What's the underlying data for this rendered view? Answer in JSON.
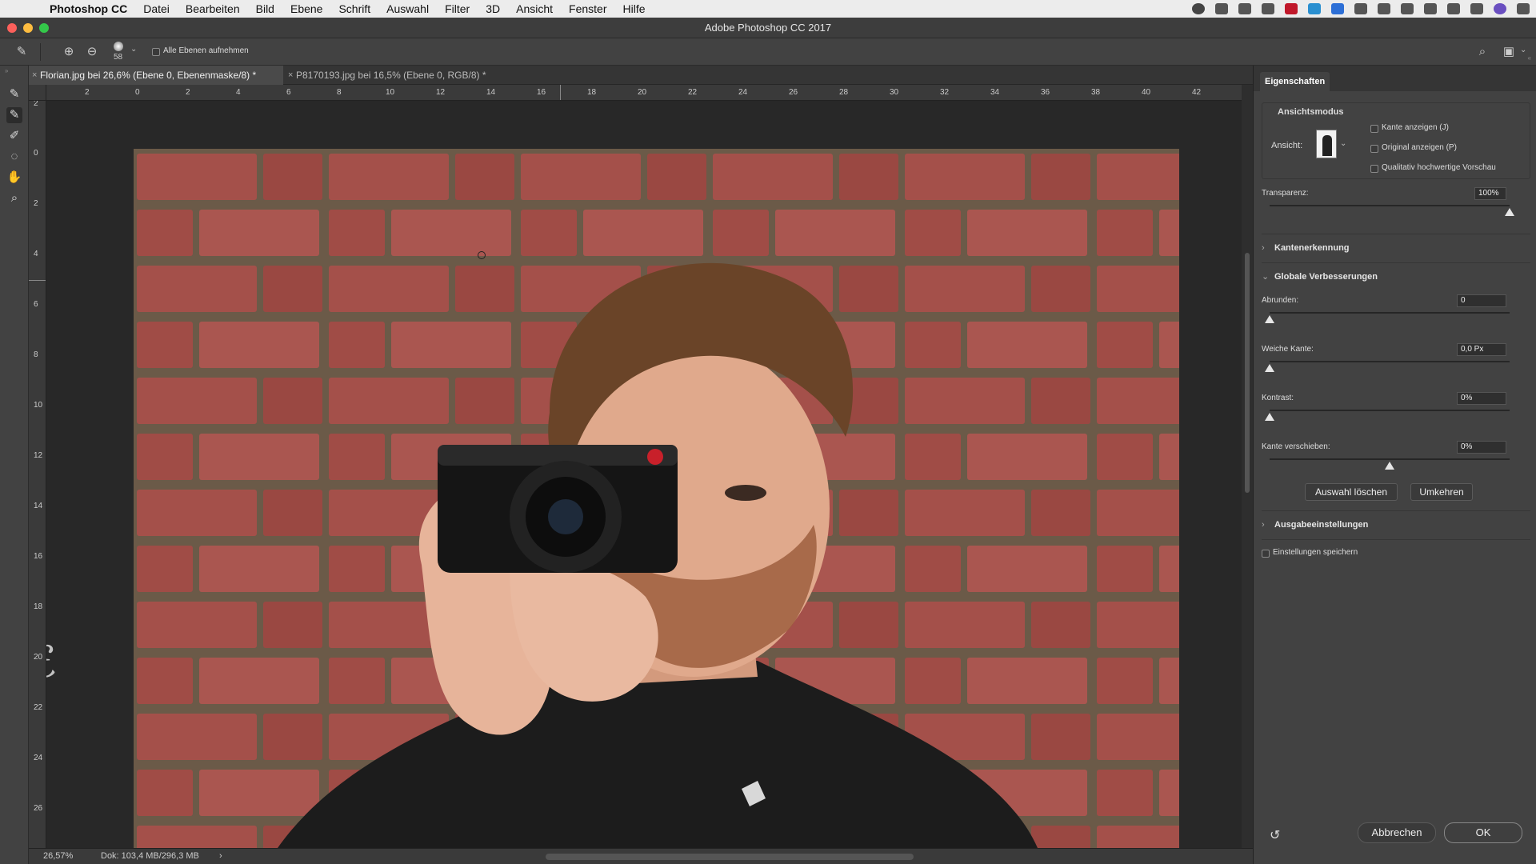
{
  "menubar": {
    "app_name": "Photoshop CC",
    "items": [
      "Datei",
      "Bearbeiten",
      "Bild",
      "Ebene",
      "Schrift",
      "Auswahl",
      "Filter",
      "3D",
      "Ansicht",
      "Fenster",
      "Hilfe"
    ]
  },
  "window": {
    "title": "Adobe Photoshop CC 2017"
  },
  "options_bar": {
    "brush_size": "58",
    "sample_all_layers_label": "Alle Ebenen aufnehmen"
  },
  "tabs": [
    {
      "label": "Florian.jpg bei 26,6% (Ebene 0, Ebenenmaske/8) *",
      "active": true
    },
    {
      "label": "P8170193.jpg bei 16,5% (Ebene 0, RGB/8) *",
      "active": false
    }
  ],
  "ruler": {
    "h_labels": [
      "2",
      "0",
      "2",
      "4",
      "6",
      "8",
      "10",
      "12",
      "14",
      "16",
      "18",
      "20",
      "22",
      "24",
      "26",
      "28",
      "30",
      "32",
      "34",
      "36",
      "38",
      "40",
      "42"
    ],
    "v_labels": [
      "2",
      "0",
      "2",
      "4",
      "6",
      "8",
      "10",
      "12",
      "14",
      "16",
      "18",
      "20",
      "22",
      "24",
      "26"
    ]
  },
  "status": {
    "zoom": "26,57%",
    "doc": "Dok: 103,4 MB/296,3 MB",
    "arrow": "›"
  },
  "properties": {
    "tab_title": "Eigenschaften",
    "view_mode_label": "Ansichtsmodus",
    "view_label": "Ansicht:",
    "checkboxes": [
      "Kante anzeigen (J)",
      "Original anzeigen (P)",
      "Qualitativ hochwertige Vorschau"
    ],
    "transparency": {
      "label": "Transparenz:",
      "value": "100%",
      "level": 1.0
    },
    "sections": {
      "edge_detection": "Kantenerkennung",
      "global_refinements": "Globale Verbesserungen",
      "output_settings": "Ausgabeeinstellungen"
    },
    "sliders": [
      {
        "label": "Abrunden:",
        "value": "0",
        "level": 0.0
      },
      {
        "label": "Weiche Kante:",
        "value": "0,0 Px",
        "level": 0.0
      },
      {
        "label": "Kontrast:",
        "value": "0%",
        "level": 0.0
      },
      {
        "label": "Kante verschieben:",
        "value": "0%",
        "level": 0.5
      }
    ],
    "clear_selection_button": "Auswahl löschen",
    "invert_button": "Umkehren",
    "remember_settings_label": "Einstellungen speichern",
    "cancel_button": "Abbrechen",
    "ok_button": "OK"
  }
}
